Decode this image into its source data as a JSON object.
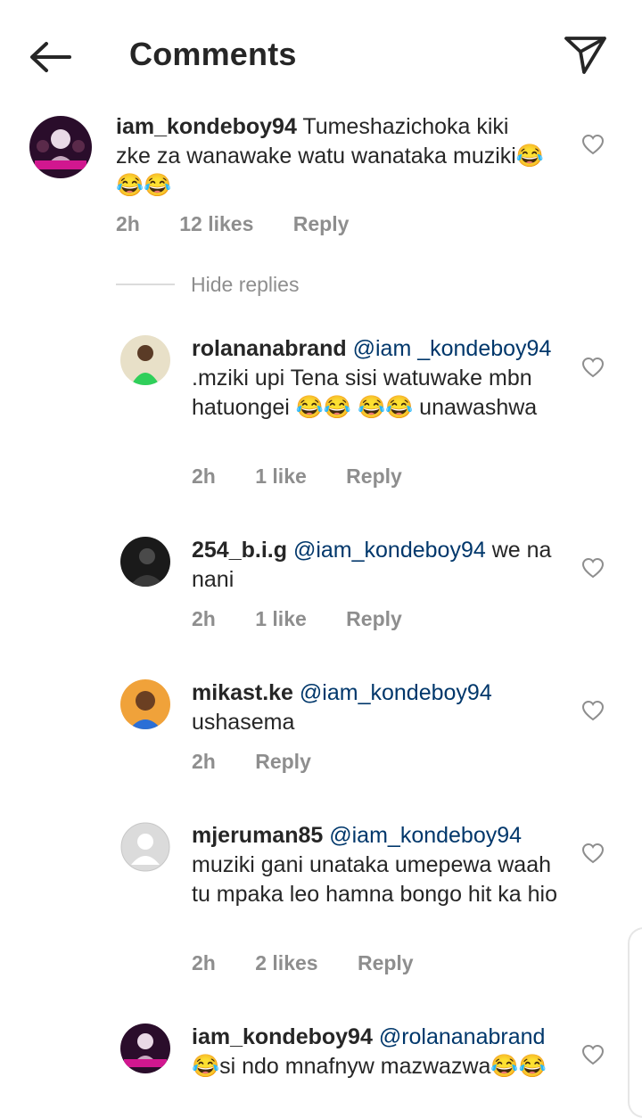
{
  "header": {
    "title": "Comments",
    "back_icon": "arrow-left-icon",
    "share_icon": "paper-plane-icon"
  },
  "comments": [
    {
      "username": "iam_kondeboy94",
      "mention": "",
      "body": " Tumeshazichoka kiki zke za wanawake watu wanataka muziki😂😂😂",
      "time": "2h",
      "likes": "12 likes",
      "reply": "Reply"
    }
  ],
  "hide_replies": "Hide replies",
  "replies": [
    {
      "username": "rolananabrand",
      "mention": "@iam _kondeboy94",
      "body": " .mziki upi Tena sisi watuwake mbn hatuongei 😂😂 😂😂 unawashwa",
      "time": "2h",
      "likes": "1 like",
      "reply": "Reply"
    },
    {
      "username": "254_b.i.g",
      "mention": "@iam_kondeboy94",
      "body": " we na nani",
      "time": "2h",
      "likes": "1 like",
      "reply": "Reply"
    },
    {
      "username": "mikast.ke",
      "mention": "@iam_kondeboy94",
      "body": " ushasema",
      "time": "2h",
      "likes": "",
      "reply": "Reply"
    },
    {
      "username": "mjeruman85",
      "mention": "@iam_kondeboy94",
      "body": " muziki gani unataka umepewa waah tu mpaka leo hamna bongo hit ka hio",
      "time": "2h",
      "likes": "2 likes",
      "reply": "Reply"
    },
    {
      "username": "iam_kondeboy94",
      "mention": "@rolananabrand",
      "body": " 😂si ndo mnafnyw mazwazwa😂😂",
      "time": "",
      "likes": "",
      "reply": ""
    }
  ],
  "colors": {
    "text": "#262626",
    "meta": "#8e8e8e",
    "mention": "#00376b"
  }
}
